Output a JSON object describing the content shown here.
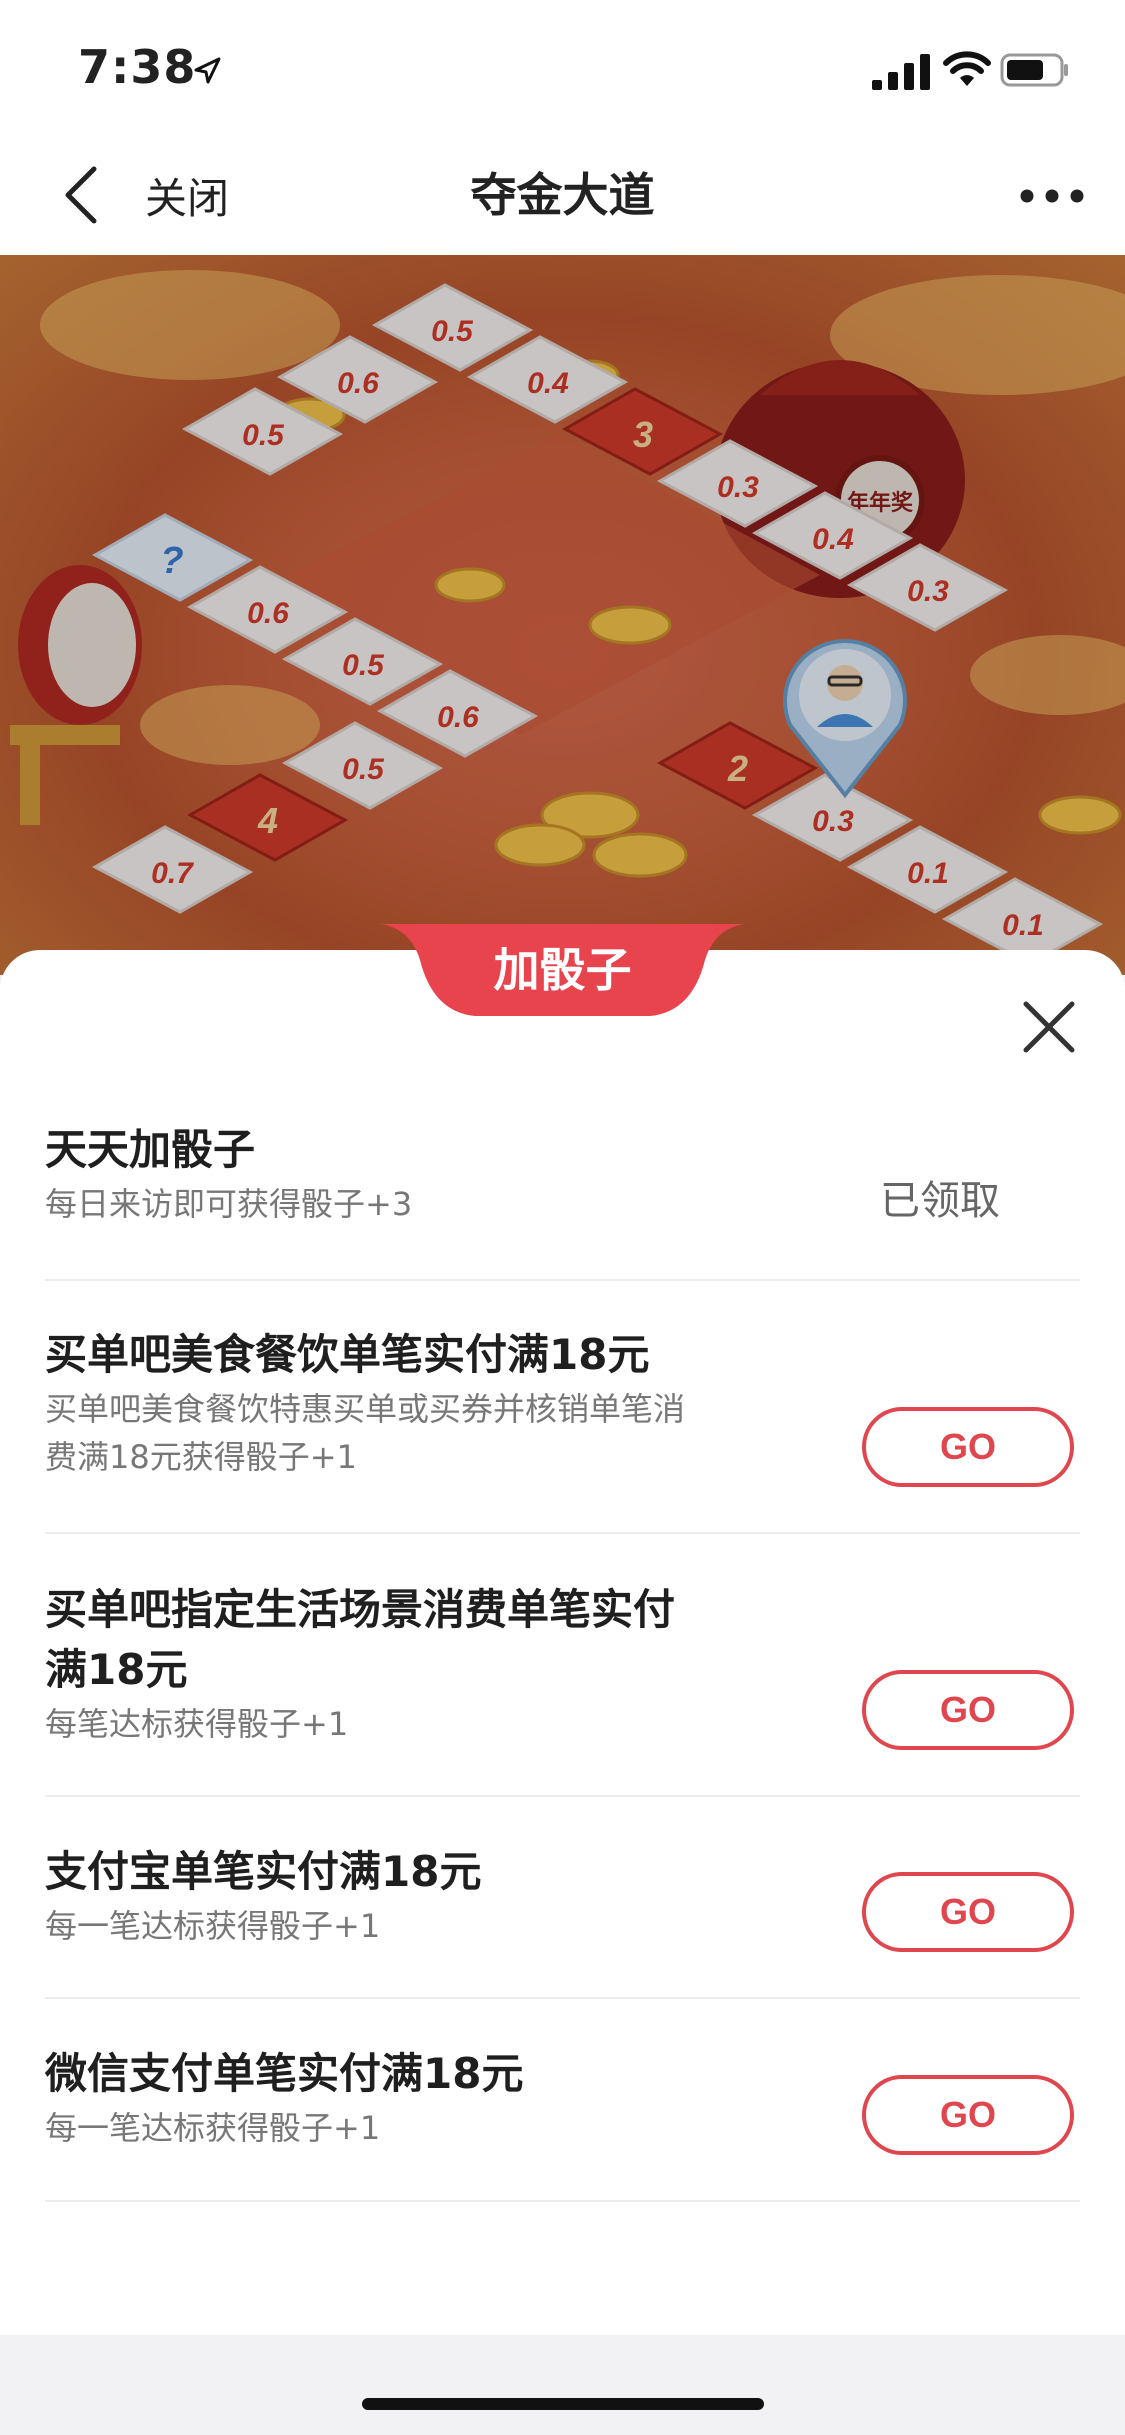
{
  "status_bar": {
    "time": "7:38"
  },
  "nav": {
    "close_label": "关闭",
    "title": "夺金大道"
  },
  "board": {
    "tiles": [
      "0.5",
      "0.6",
      "0.4",
      "0.5",
      "3",
      "0.3",
      "0.4",
      "0.3",
      "?",
      "0.6",
      "0.5",
      "0.6",
      "0.5",
      "2",
      "0.3",
      "4",
      "0.7",
      "0.1",
      "0.1"
    ],
    "bag_text": "年年奖"
  },
  "sheet": {
    "tab_label": "加骰子",
    "tasks": [
      {
        "title": "天天加骰子",
        "subtitle": "每日来访即可获得骰子+3",
        "action": "已领取"
      },
      {
        "title": "买单吧美食餐饮单笔实付满18元",
        "subtitle_lines": [
          "买单吧美食餐饮特惠买单或买券并核销单笔消",
          "费满18元获得骰子+1"
        ],
        "action": "GO"
      },
      {
        "title_lines": [
          "买单吧指定生活场景消费单笔实付",
          "满18元"
        ],
        "subtitle": "每笔达标获得骰子+1",
        "action": "GO"
      },
      {
        "title": "支付宝单笔实付满18元",
        "subtitle": "每一笔达标获得骰子+1",
        "action": "GO"
      },
      {
        "title": "微信支付单笔实付满18元",
        "subtitle": "每一笔达标获得骰子+1",
        "action": "GO"
      }
    ]
  },
  "colors": {
    "accent": "#e0464e",
    "tile_red": "#cf3a2a",
    "gold": "#f2c14a"
  }
}
